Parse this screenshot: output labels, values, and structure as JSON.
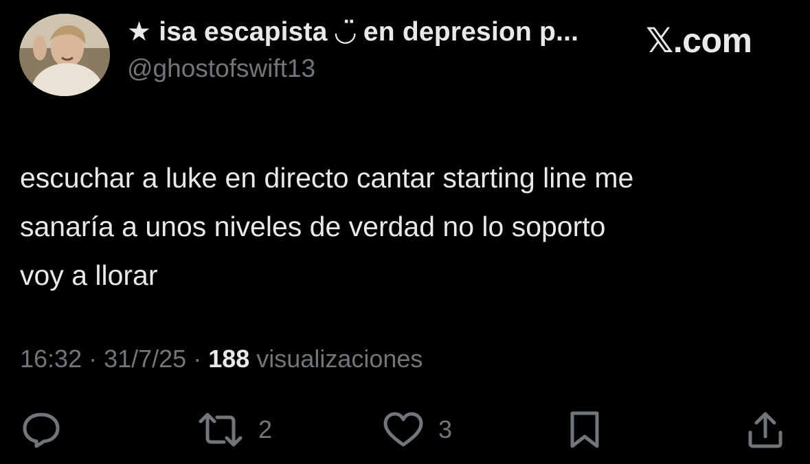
{
  "profile": {
    "display_name": "★ isa escapista ◡̈ en depresion p...",
    "handle": "@ghostofswift13",
    "avatar_icon": "avatar-photo"
  },
  "brand": {
    "label": "𝕏.com"
  },
  "tweet": {
    "text": "escuchar a luke en directo cantar starting line me\nsanaría a unos niveles de verdad no lo soporto\nvoy a llorar"
  },
  "meta": {
    "time": "16:32",
    "separator1": " · ",
    "date": "31/7/25",
    "separator2": " · ",
    "views_count": "188",
    "views_label": " visualizaciones"
  },
  "actions": {
    "reply_icon": "reply-icon",
    "retweet_icon": "retweet-icon",
    "retweet_count": "2",
    "like_icon": "heart-icon",
    "like_count": "3",
    "bookmark_icon": "bookmark-icon",
    "share_icon": "share-icon"
  },
  "colors": {
    "background": "#000000",
    "primary_text": "#e7e9ea",
    "secondary_text": "#71767b"
  }
}
